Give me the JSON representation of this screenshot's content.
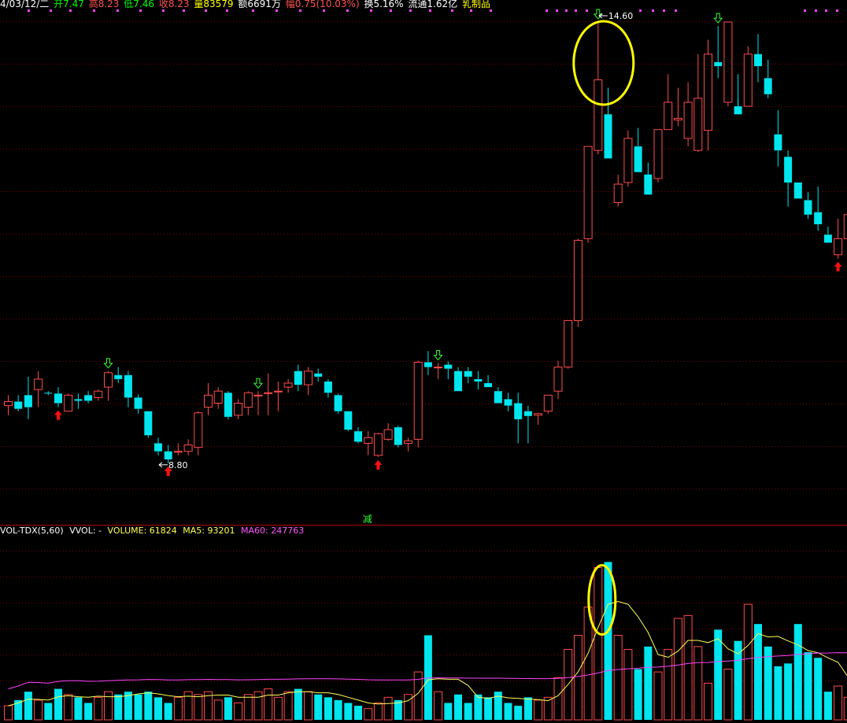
{
  "header": {
    "date": "4/03/12/二",
    "open": "开7.47",
    "high": "高8.23",
    "low": "低7.46",
    "close": "收8.23",
    "volume": "量83579",
    "amount": "额6691万",
    "change": "幅0.75(10.03%)",
    "turnover": "换5.16%",
    "float": "流通1.62亿",
    "sector": "乳制品"
  },
  "colors": {
    "up": "#ff4b4b",
    "down": "#00e5ee",
    "ma5": "#ffff55",
    "ma60": "#ff44ff",
    "grid": "#7a0000",
    "highlight": "#ffff00"
  },
  "volume_header": {
    "name": "VOL-TDX(5,60)",
    "vvol": "VVOL: -",
    "volume": "VOLUME: 61824",
    "ma5": "MA5: 93201",
    "ma60": "MA60: 247763"
  },
  "annotations": {
    "high_label": "14.60",
    "low_label": "8.80",
    "signal_text": "减"
  },
  "chart_data": [
    {
      "type": "candlestick",
      "title": "",
      "candles": [
        [
          9.82,
          9.95,
          9.7,
          9.87
        ],
        [
          9.87,
          9.95,
          9.75,
          9.78
        ],
        [
          9.95,
          10.18,
          9.65,
          9.8
        ],
        [
          10.02,
          10.25,
          9.8,
          10.15
        ],
        [
          9.98,
          10.0,
          9.95,
          9.97
        ],
        [
          9.97,
          10.05,
          9.8,
          9.85
        ],
        [
          9.75,
          9.97,
          9.75,
          9.95
        ],
        [
          9.9,
          9.97,
          9.78,
          9.88
        ],
        [
          9.95,
          10.0,
          9.85,
          9.88
        ],
        [
          9.92,
          10.02,
          9.88,
          10.0
        ],
        [
          10.05,
          10.25,
          9.88,
          10.23
        ],
        [
          10.2,
          10.3,
          10.1,
          10.15
        ],
        [
          10.2,
          10.25,
          9.8,
          9.92
        ],
        [
          9.92,
          9.96,
          9.72,
          9.78
        ],
        [
          9.75,
          9.75,
          9.42,
          9.45
        ],
        [
          9.35,
          9.42,
          9.2,
          9.25
        ],
        [
          9.25,
          9.33,
          9.1,
          9.15
        ],
        [
          9.25,
          9.35,
          9.2,
          9.25
        ],
        [
          9.25,
          9.4,
          9.2,
          9.33
        ],
        [
          9.3,
          9.75,
          9.2,
          9.73
        ],
        [
          9.8,
          10.1,
          9.7,
          9.95
        ],
        [
          9.85,
          10.05,
          9.78,
          10.0
        ],
        [
          9.98,
          10.0,
          9.65,
          9.68
        ],
        [
          9.7,
          9.9,
          9.65,
          9.85
        ],
        [
          9.8,
          10.0,
          9.7,
          9.98
        ],
        [
          9.95,
          10.0,
          9.7,
          9.95
        ],
        [
          9.97,
          10.22,
          9.7,
          9.98
        ],
        [
          10.0,
          10.12,
          9.75,
          10.0
        ],
        [
          10.05,
          10.15,
          9.98,
          10.1
        ],
        [
          10.25,
          10.33,
          10.0,
          10.08
        ],
        [
          10.08,
          10.3,
          9.95,
          10.25
        ],
        [
          10.22,
          10.28,
          10.12,
          10.18
        ],
        [
          10.12,
          10.15,
          9.92,
          9.98
        ],
        [
          9.95,
          9.97,
          9.72,
          9.75
        ],
        [
          9.75,
          9.75,
          9.5,
          9.52
        ],
        [
          9.5,
          9.55,
          9.35,
          9.37
        ],
        [
          9.35,
          9.5,
          9.2,
          9.42
        ],
        [
          9.2,
          9.48,
          9.18,
          9.47
        ],
        [
          9.4,
          9.6,
          9.38,
          9.52
        ],
        [
          9.55,
          9.57,
          9.3,
          9.33
        ],
        [
          9.35,
          9.42,
          9.25,
          9.38
        ],
        [
          9.4,
          10.38,
          9.3,
          10.36
        ],
        [
          10.36,
          10.5,
          10.2,
          10.3
        ],
        [
          10.3,
          10.35,
          10.15,
          10.3
        ],
        [
          10.33,
          10.37,
          10.15,
          10.28
        ],
        [
          10.25,
          10.3,
          10.0,
          10.0
        ],
        [
          10.25,
          10.3,
          10.1,
          10.18
        ],
        [
          10.15,
          10.25,
          10.02,
          10.12
        ],
        [
          10.1,
          10.2,
          10.05,
          10.05
        ],
        [
          10.0,
          10.05,
          9.9,
          9.85
        ],
        [
          9.9,
          9.98,
          9.75,
          9.82
        ],
        [
          9.85,
          9.98,
          9.35,
          9.65
        ],
        [
          9.75,
          9.82,
          9.35,
          9.69
        ],
        [
          9.7,
          9.73,
          9.58,
          9.72
        ],
        [
          9.75,
          9.85,
          9.72,
          9.95
        ],
        [
          10.0,
          10.38,
          9.9,
          10.3
        ],
        [
          10.3,
          10.88,
          10.28,
          10.88
        ],
        [
          10.88,
          11.9,
          10.8,
          11.88
        ],
        [
          11.9,
          13.05,
          11.85,
          13.05
        ],
        [
          13.0,
          14.6,
          12.95,
          13.88
        ],
        [
          13.45,
          13.78,
          12.98,
          12.9
        ],
        [
          12.35,
          12.7,
          12.3,
          12.58
        ],
        [
          12.6,
          13.25,
          12.55,
          13.15
        ],
        [
          13.05,
          13.28,
          12.75,
          12.73
        ],
        [
          12.7,
          12.85,
          12.48,
          12.45
        ],
        [
          12.65,
          13.26,
          12.6,
          13.26
        ],
        [
          13.26,
          13.95,
          13.28,
          13.6
        ],
        [
          13.38,
          13.78,
          13.3,
          13.4
        ],
        [
          13.15,
          13.85,
          13.05,
          13.6
        ],
        [
          13.0,
          14.2,
          12.98,
          13.65
        ],
        [
          13.25,
          14.38,
          13.0,
          14.2
        ],
        [
          14.1,
          14.55,
          13.9,
          14.05
        ],
        [
          13.6,
          14.5,
          13.55,
          14.6
        ],
        [
          13.55,
          13.95,
          13.65,
          13.45
        ],
        [
          13.55,
          14.3,
          13.55,
          14.2
        ],
        [
          14.2,
          14.45,
          13.85,
          14.05
        ],
        [
          13.9,
          14.13,
          13.65,
          13.7
        ],
        [
          13.2,
          13.5,
          12.8,
          13.0
        ],
        [
          12.92,
          13.0,
          12.3,
          12.6
        ],
        [
          12.6,
          12.6,
          12.4,
          12.4
        ],
        [
          12.38,
          12.48,
          12.15,
          12.2
        ],
        [
          12.23,
          12.55,
          12.0,
          12.08
        ],
        [
          11.95,
          12.05,
          11.85,
          11.85
        ],
        [
          11.7,
          12.15,
          11.65,
          11.9
        ],
        [
          11.9,
          12.27,
          11.85,
          12.2
        ]
      ],
      "ylim": [
        8.6,
        14.6
      ],
      "markers": [
        {
          "type": "buy",
          "index": 5
        },
        {
          "type": "buy",
          "index": 16
        },
        {
          "type": "buy",
          "index": 37
        },
        {
          "type": "buy",
          "index": 83
        },
        {
          "type": "sell",
          "index": 10
        },
        {
          "type": "sell",
          "index": 25
        },
        {
          "type": "sell",
          "index": 43
        },
        {
          "type": "sell",
          "index": 59
        },
        {
          "type": "sell",
          "index": 71
        }
      ],
      "circle_index": 59,
      "high_index": 59,
      "low_index": 15
    },
    {
      "type": "bar",
      "title": "",
      "volumes": [
        5,
        7,
        10,
        7,
        6,
        11,
        9,
        8,
        6,
        8,
        10,
        9,
        10,
        9,
        10,
        8,
        6,
        8,
        10,
        9,
        10,
        7,
        8,
        6,
        9,
        10,
        11,
        8,
        10,
        11,
        10,
        9,
        8,
        7,
        6,
        5,
        4,
        6,
        8,
        7,
        9,
        17,
        30,
        10,
        6,
        9,
        6,
        9,
        8,
        10,
        6,
        5,
        8,
        7,
        8,
        15,
        25,
        30,
        40,
        54,
        56,
        30,
        25,
        18,
        26,
        17,
        25,
        36,
        37,
        26,
        13,
        32,
        18,
        28,
        41,
        34,
        26,
        19,
        20,
        34,
        24,
        22,
        10,
        12,
        8
      ]
    }
  ]
}
